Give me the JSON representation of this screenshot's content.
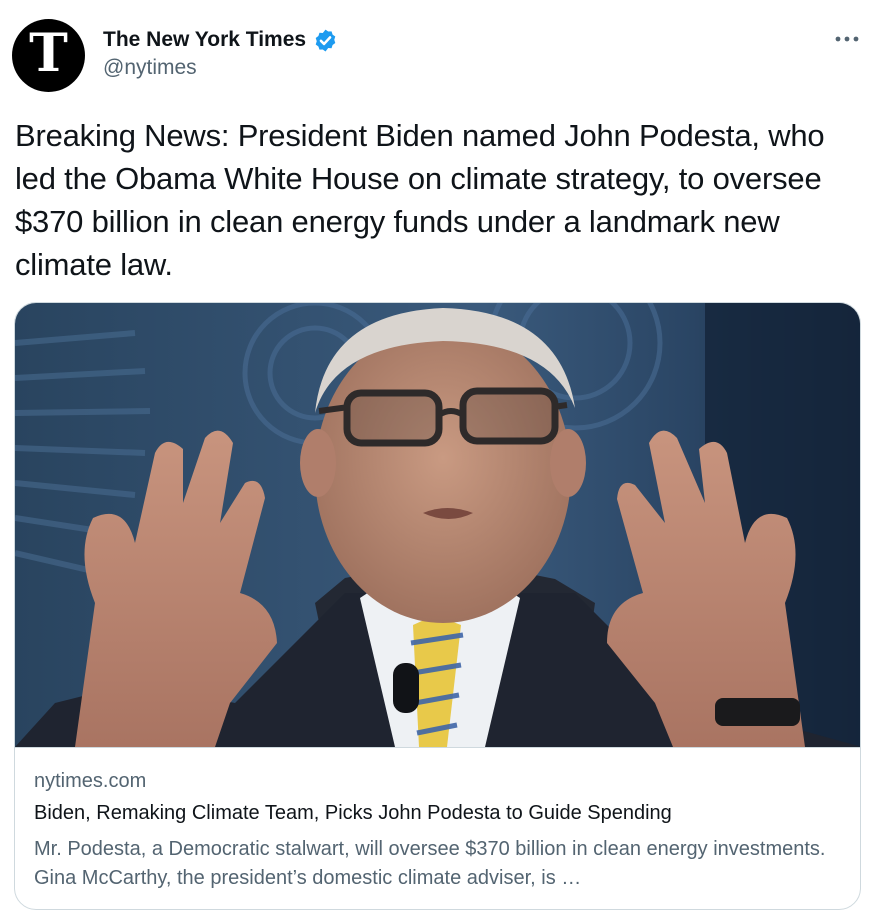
{
  "author": {
    "name": "The New York Times",
    "handle": "@nytimes",
    "verified": true,
    "avatar_glyph": "T",
    "verified_color": "#1d9bf0"
  },
  "menu": {
    "more_icon": "more-horizontal-icon"
  },
  "tweet": {
    "text": "Breaking News: President Biden named John Podesta, who led the Obama White House on climate strategy, to oversee $370 billion in clean energy funds under a landmark new climate law."
  },
  "card": {
    "domain": "nytimes.com",
    "title": "Biden, Remaking Climate Team, Picks John Podesta to Guide Spending",
    "description": "Mr. Podesta, a Democratic stalwart, will oversee $370 billion in clean energy investments. Gina McCarthy, the president’s domestic climate adviser, is …",
    "image_subject": "John Podesta gesturing with both hands, wearing glasses, dark suit, white shirt and yellow-blue striped tie"
  },
  "colors": {
    "text_primary": "#0f1419",
    "text_secondary": "#536471",
    "border": "#cfd9de",
    "accent": "#1d9bf0"
  }
}
